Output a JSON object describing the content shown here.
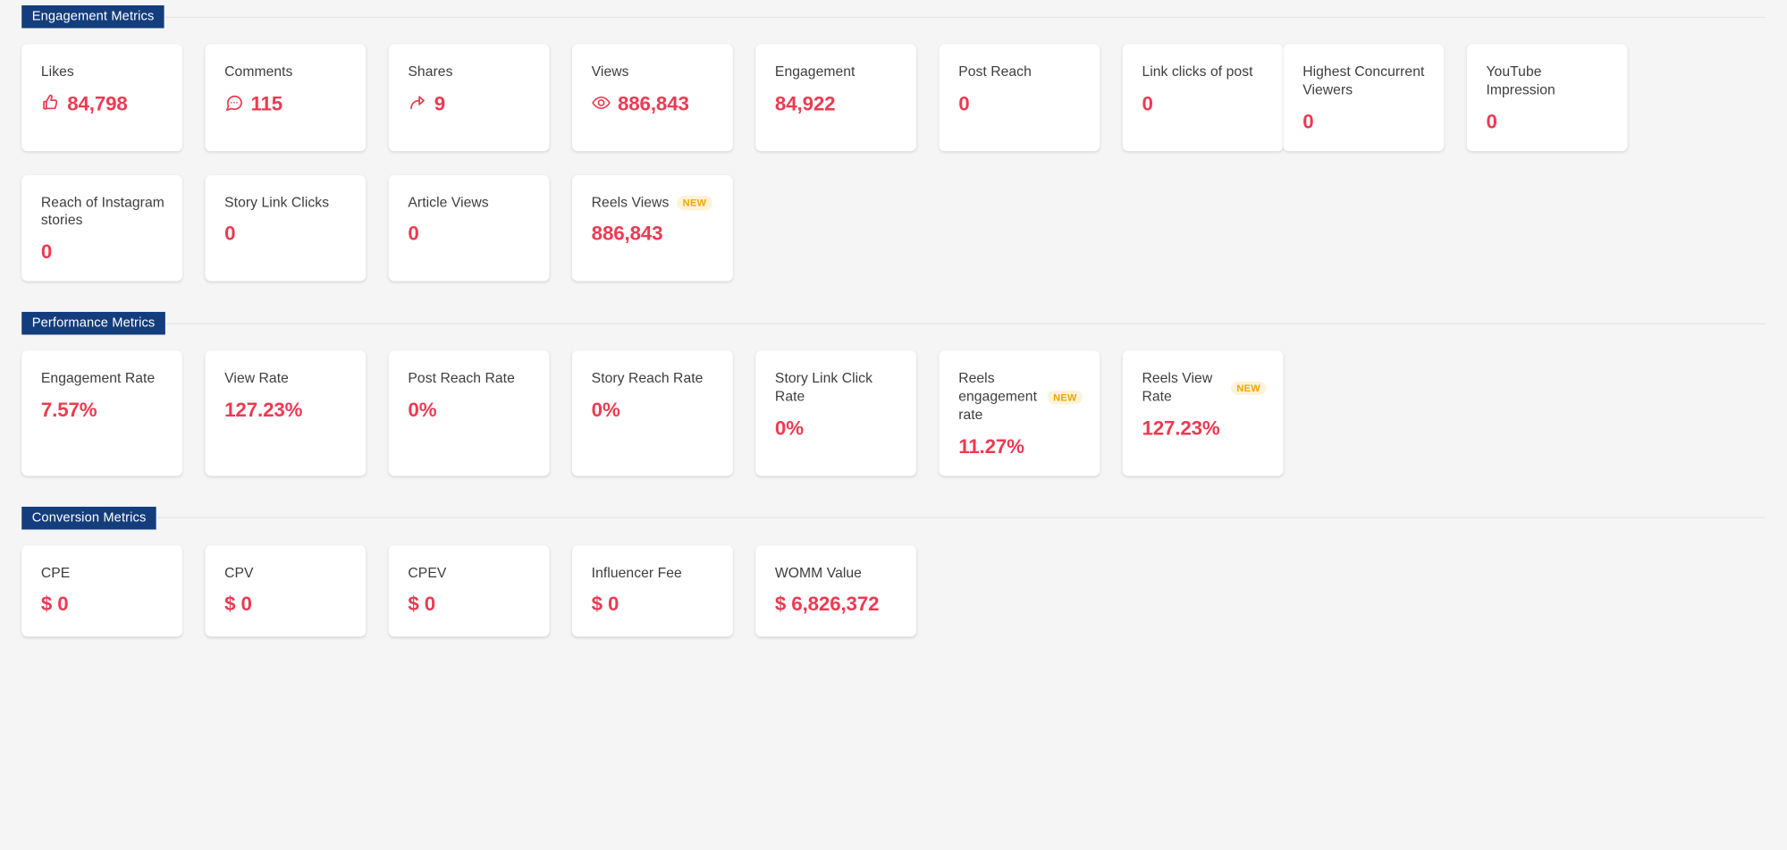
{
  "theme": {
    "section_tag_bg": "#133d7d",
    "section_tag_text": "#ffffff",
    "value_color": "#ed3a52",
    "label_color": "#3d3d3d",
    "badge_bg": "#fdf3d8",
    "badge_text": "#f0a500",
    "page_bg": "#f5f5f6",
    "card_bg": "#ffffff"
  },
  "sections": [
    {
      "title": "Engagement Metrics",
      "cards": [
        {
          "label": "Likes",
          "value": "84,798",
          "icon": "thumbs-up-icon"
        },
        {
          "label": "Comments",
          "value": "115",
          "icon": "comment-bubble-icon"
        },
        {
          "label": "Shares",
          "value": "9",
          "icon": "share-arrow-icon"
        },
        {
          "label": "Views",
          "value": "886,843",
          "icon": "eye-icon"
        },
        {
          "label": "Engagement",
          "value": "84,922",
          "icon": null
        },
        {
          "label": "Post Reach",
          "value": "0",
          "icon": null
        },
        {
          "label": "Link clicks of post",
          "value": "0",
          "icon": null
        },
        {
          "label": "Highest Concurrent Viewers",
          "value": "0",
          "icon": null
        },
        {
          "label": "YouTube Impression",
          "value": "0",
          "icon": null
        },
        {
          "label": "Reach of Instagram stories",
          "value": "0",
          "icon": null
        },
        {
          "label": "Story Link Clicks",
          "value": "0",
          "icon": null
        },
        {
          "label": "Article Views",
          "value": "0",
          "icon": null
        },
        {
          "label": "Reels Views",
          "value": "886,843",
          "icon": null,
          "badge": "NEW"
        }
      ]
    },
    {
      "title": "Performance Metrics",
      "cards": [
        {
          "label": "Engagement Rate",
          "value": "7.57%",
          "icon": null
        },
        {
          "label": "View Rate",
          "value": "127.23%",
          "icon": null
        },
        {
          "label": "Post Reach Rate",
          "value": "0%",
          "icon": null
        },
        {
          "label": "Story Reach Rate",
          "value": "0%",
          "icon": null
        },
        {
          "label": "Story Link Click Rate",
          "value": "0%",
          "icon": null
        },
        {
          "label": "Reels engagement rate",
          "value": "11.27%",
          "icon": null,
          "badge": "NEW"
        },
        {
          "label": "Reels View Rate",
          "value": "127.23%",
          "icon": null,
          "badge": "NEW"
        }
      ]
    },
    {
      "title": "Conversion Metrics",
      "cards": [
        {
          "label": "CPE",
          "value": "$ 0",
          "icon": null
        },
        {
          "label": "CPV",
          "value": "$ 0",
          "icon": null
        },
        {
          "label": "CPEV",
          "value": "$ 0",
          "icon": null
        },
        {
          "label": "Influencer Fee",
          "value": "$ 0",
          "icon": null
        },
        {
          "label": "WOMM Value",
          "value": "$ 6,826,372",
          "icon": null
        }
      ]
    }
  ]
}
